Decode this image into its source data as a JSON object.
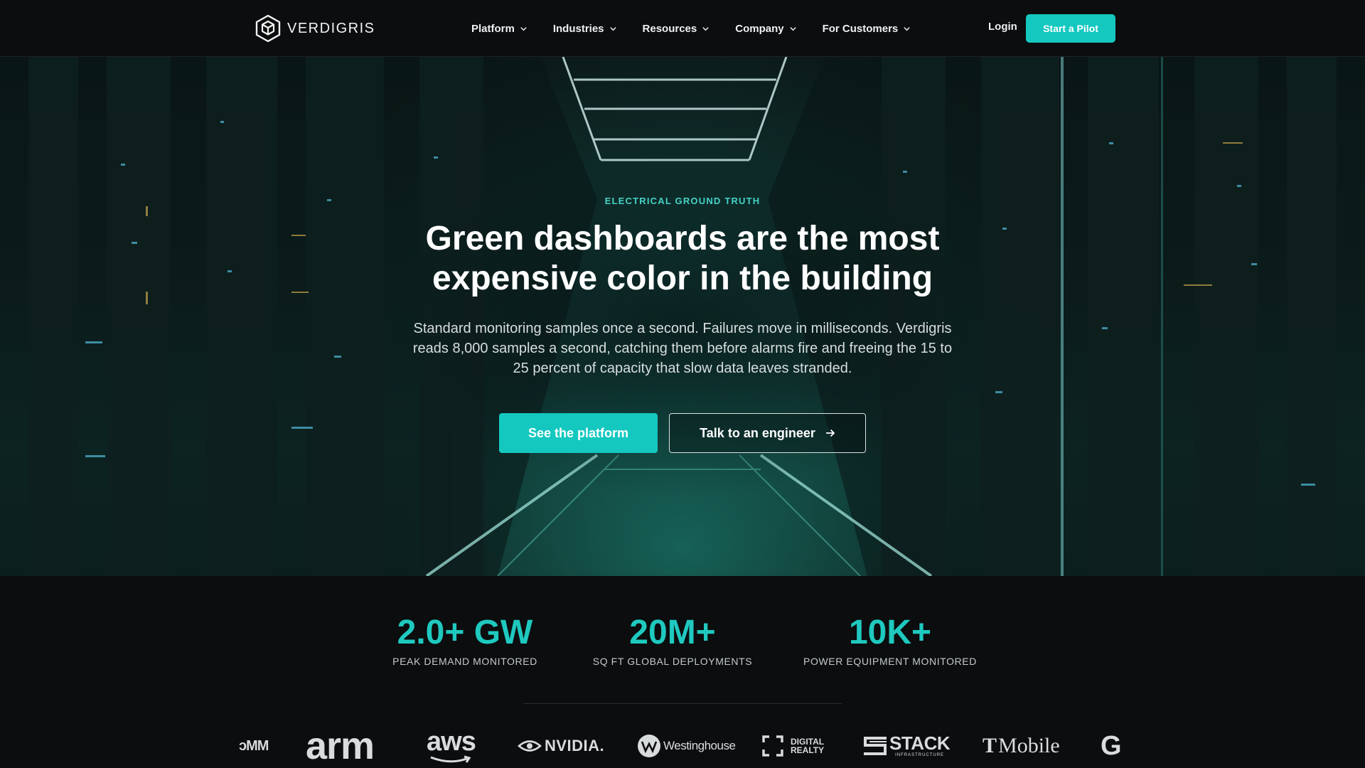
{
  "brand": {
    "name": "VERDIGRIS",
    "logo_icon": "hexagon-cube-icon"
  },
  "nav": {
    "items": [
      {
        "label": "Platform"
      },
      {
        "label": "Industries"
      },
      {
        "label": "Resources"
      },
      {
        "label": "Company"
      },
      {
        "label": "For Customers"
      }
    ],
    "login_label": "Login",
    "cta_label": "Start a Pilot"
  },
  "hero": {
    "eyebrow": "ELECTRICAL GROUND TRUTH",
    "headline": "Green dashboards are the most expensive color in the building",
    "subcopy": "Standard monitoring samples once a second. Failures move in milliseconds. Verdigris reads 8,000 samples a second, catching them before alarms fire and freeing the 15 to 25 percent of capacity that slow data leaves stranded.",
    "primary_cta": "See the platform",
    "secondary_cta": "Talk to an engineer"
  },
  "stats": [
    {
      "value": "2.0+ GW",
      "label": "PEAK DEMAND MONITORED"
    },
    {
      "value": "20M+",
      "label": "SQ FT GLOBAL DEPLOYMENTS"
    },
    {
      "value": "10K+",
      "label": "POWER EQUIPMENT MONITORED"
    }
  ],
  "customer_logos": {
    "partial_left": "ᴐMM",
    "arm": "arm",
    "aws": "aws",
    "nvidia": "NVIDIA.",
    "westinghouse": "Westinghouse",
    "digital_realty_line1": "DIGITAL",
    "digital_realty_line2": "REALTY",
    "stack": "STACK",
    "stack_sub": "INFRASTRUCTURE",
    "tmobile": "Mobile",
    "tmobile_mark": "T",
    "partial_right": "G"
  },
  "colors": {
    "accent": "#14c8c0",
    "stat_value": "#1fc9bf",
    "eyebrow": "#46d2c6",
    "background": "#0b0d0e"
  }
}
